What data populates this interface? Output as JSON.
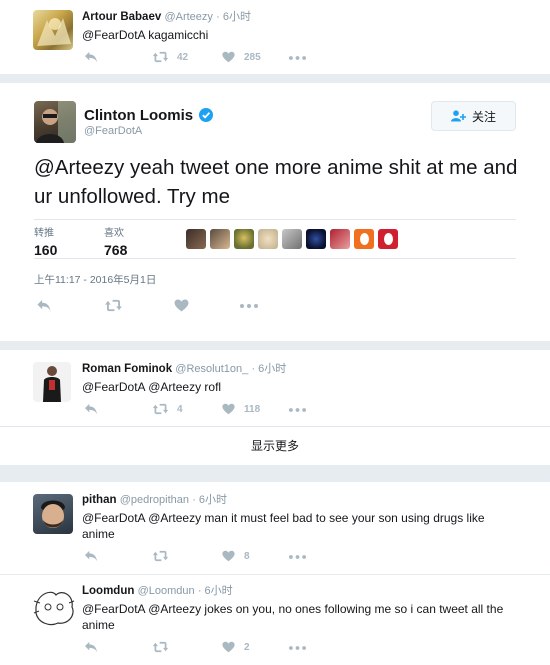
{
  "tweet1": {
    "name": "Artour Babaev",
    "handle": "@Arteezy",
    "time": "· 6小时",
    "text": "@FearDotA kagamicchi",
    "retweets": "42",
    "likes": "285"
  },
  "main": {
    "name": "Clinton Loomis",
    "handle": "@FearDotA",
    "follow_label": "关注",
    "text": "@Arteezy yeah tweet one more anime shit at me and ur unfollowed. Try me",
    "retweets_label": "转推",
    "retweets": "160",
    "likes_label": "喜欢",
    "likes": "768",
    "timestamp": "上午11:17 - 2016年5月1日",
    "verified_color": "#1da1f2"
  },
  "reply1": {
    "name": "Roman Fominok",
    "handle": "@Resolut1on_",
    "time": "· 6小时",
    "text": "@FearDotA @Arteezy rofl",
    "retweets": "4",
    "likes": "118"
  },
  "show_more": "显示更多",
  "reply2": {
    "name": "pithan",
    "handle": "@pedropithan",
    "time": "· 6小时",
    "text": "@FearDotA @Arteezy man it must feel bad to see your son using drugs like anime",
    "likes": "8"
  },
  "reply3": {
    "name": "Loomdun",
    "handle": "@Loomdun",
    "time": "· 6小时",
    "text": "@FearDotA @Arteezy jokes on you, no ones following me so i can tweet all the anime",
    "likes": "2"
  }
}
